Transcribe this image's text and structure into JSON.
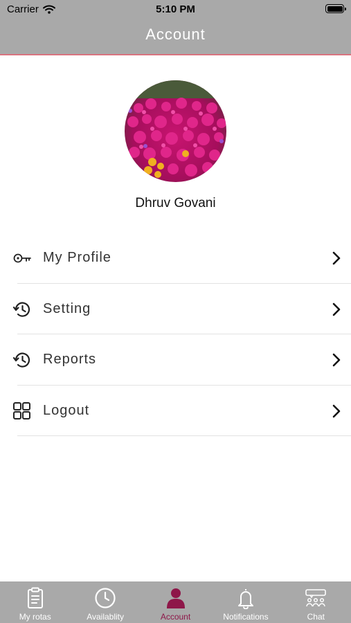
{
  "status_bar": {
    "carrier": "Carrier",
    "time": "5:10 PM"
  },
  "nav": {
    "title": "Account"
  },
  "profile": {
    "name": "Dhruv Govani"
  },
  "menu": [
    {
      "label": "My Profile",
      "icon": "key-icon"
    },
    {
      "label": "Setting",
      "icon": "history-icon"
    },
    {
      "label": "Reports",
      "icon": "history-icon"
    },
    {
      "label": "Logout",
      "icon": "grid-icon"
    }
  ],
  "tabs": [
    {
      "label": "My rotas",
      "icon": "clipboard-icon",
      "active": false
    },
    {
      "label": "Availablity",
      "icon": "clock-icon",
      "active": false
    },
    {
      "label": "Account",
      "icon": "person-icon",
      "active": true
    },
    {
      "label": "Notifications",
      "icon": "bell-icon",
      "active": false
    },
    {
      "label": "Chat",
      "icon": "chat-icon",
      "active": false
    }
  ],
  "colors": {
    "bar": "#a9a9a9",
    "accent": "#8e1749",
    "divider_line": "#d9737f"
  }
}
